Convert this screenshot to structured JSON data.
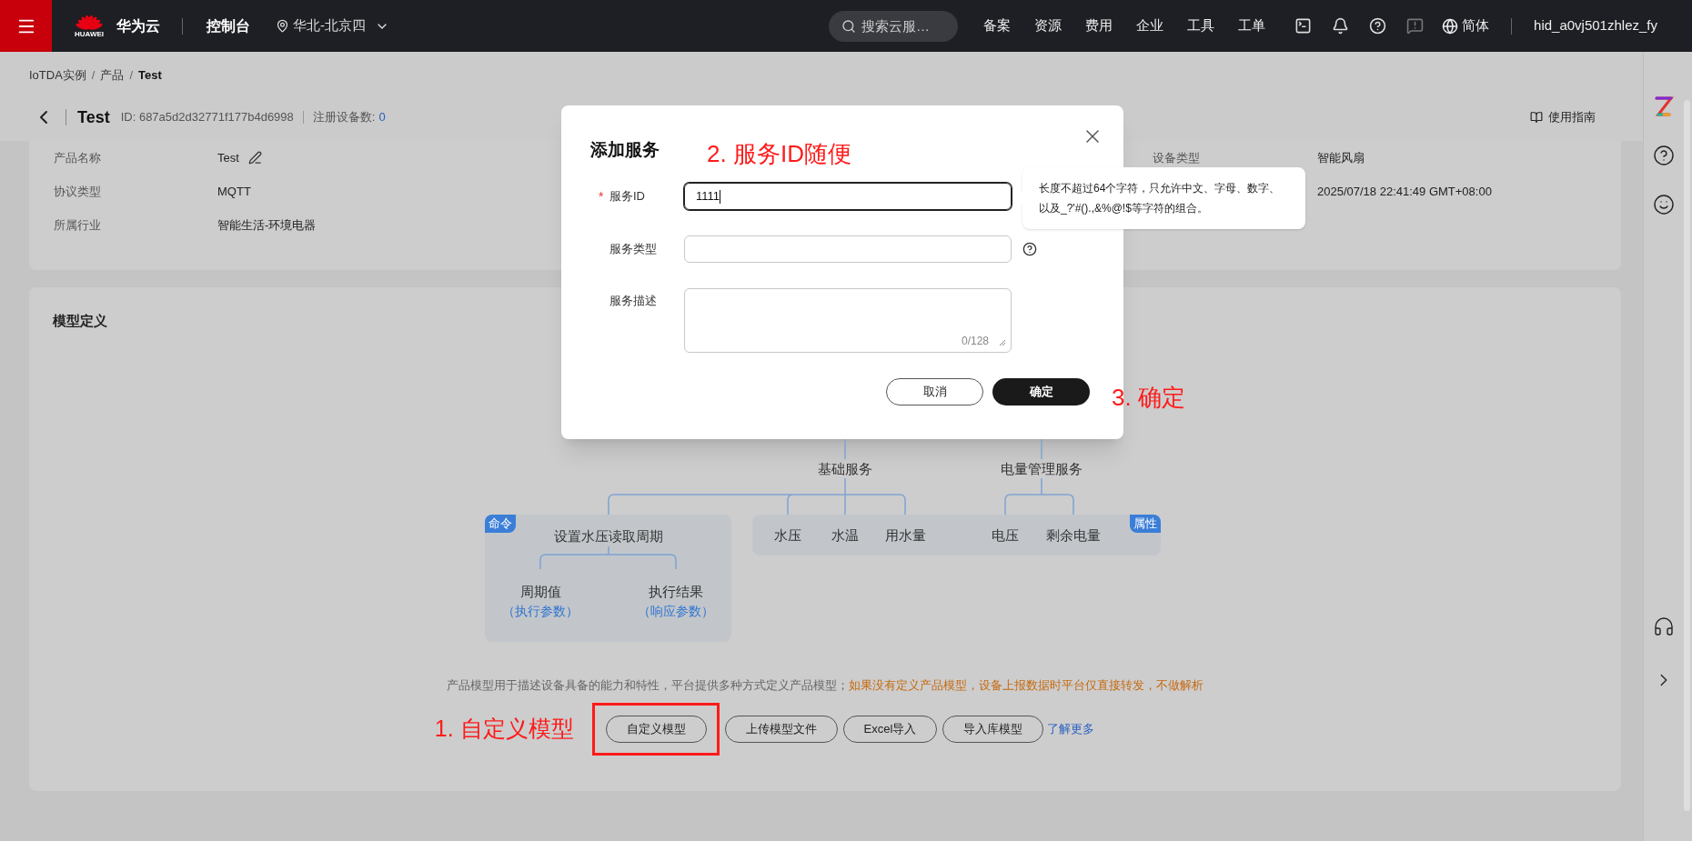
{
  "top_bar": {
    "logo_text": "HUAWEI",
    "brand": "华为云",
    "console": "控制台",
    "region": "华北-北京四",
    "search": {
      "placeholder": "搜索云服…"
    },
    "nav": [
      "备案",
      "资源",
      "费用",
      "企业",
      "工具",
      "工单"
    ],
    "language": "简体",
    "user": "hid_a0vj501zhlez_fy"
  },
  "breadcrumb_separator": "/",
  "breadcrumb": [
    {
      "label": "IoTDA实例",
      "current": false
    },
    {
      "label": "产品",
      "current": false
    },
    {
      "label": "Test",
      "current": true
    }
  ],
  "header": {
    "title": "Test",
    "id": "ID: 687a5d2d32771f177b4d6998",
    "device_count_label": "注册设备数:",
    "device_count": "0",
    "guide": "使用指南"
  },
  "product_info": [
    {
      "label": "产品名称",
      "value": "Test",
      "editable": true,
      "side_label": "设备类型",
      "side_value": "智能风扇"
    },
    {
      "label": "协议类型",
      "value": "MQTT",
      "editable": false,
      "side_value": "2025/07/18 22:41:49 GMT+08:00"
    },
    {
      "label": "所属行业",
      "value": "智能生活-环境电器",
      "editable": false
    }
  ],
  "model_definition": {
    "title": "模型定义",
    "diagram": {
      "services": [
        "基础服务",
        "电量管理服务"
      ],
      "command": {
        "tag": "命令",
        "name": "设置水压读取周期",
        "params": [
          {
            "name": "周期值",
            "role": "（执行参数）"
          },
          {
            "name": "执行结果",
            "role": "（响应参数）"
          }
        ]
      },
      "properties": {
        "tag": "属性",
        "items": [
          "水压",
          "水温",
          "用水量",
          "电压",
          "剩余电量"
        ]
      }
    },
    "description": "产品模型用于描述设备具备的能力和特性，平台提供多种方式定义产品模型；",
    "warning": "如果没有定义产品模型，设备上报数据时平台仅直接转发，不做解析",
    "buttons": [
      {
        "label": "自定义模型",
        "highlighted": true
      },
      {
        "label": "上传模型文件",
        "highlighted": false
      },
      {
        "label": "Excel导入",
        "highlighted": false
      },
      {
        "label": "导入库模型",
        "highlighted": false
      }
    ],
    "link": "了解更多"
  },
  "dialog": {
    "title": "添加服务",
    "required_mark": "*",
    "fields": [
      {
        "label": "服务ID",
        "kind": "input",
        "required": true,
        "focused": true,
        "value": "1111",
        "help": false
      },
      {
        "label": "服务类型",
        "kind": "input",
        "required": false,
        "focused": false,
        "help": true
      },
      {
        "label": "服务描述",
        "kind": "textarea",
        "required": false,
        "focused": false,
        "counter": "0/128",
        "help": false
      }
    ],
    "tooltip": "长度不超过64个字符，只允许中文、字母、数字、以及_?'#().,&%@!$等字符的组合。",
    "buttons": [
      {
        "label": "取消",
        "primary": false
      },
      {
        "label": "确定",
        "primary": true
      }
    ]
  },
  "annotations": [
    "2. 服务ID随便",
    "3. 确定",
    "1. 自定义模型"
  ]
}
